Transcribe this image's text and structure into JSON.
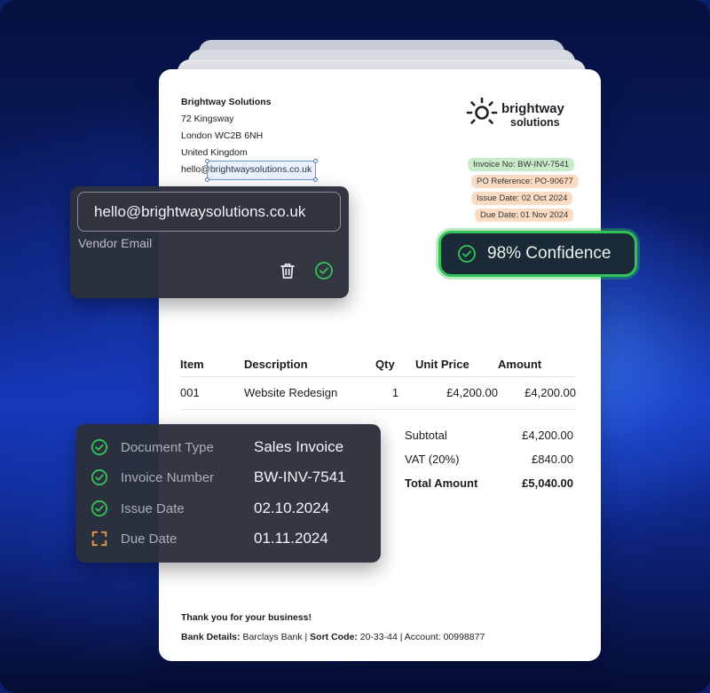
{
  "vendor": {
    "name": "Brightway Solutions",
    "address_line1": "72 Kingsway",
    "address_line2": "London WC2B 6NH",
    "country": "United Kingdom",
    "email": "hello@brightwaysolutions.co.uk"
  },
  "logo": {
    "line1": "brightway",
    "line2": "solutions"
  },
  "tags": {
    "invoice_no": "Invoice No: BW-INV-7541",
    "po_reference": "PO Reference: PO-90677",
    "issue_date": "Issue Date: 02 Oct 2024",
    "due_date": "Due Date: 01 Nov 2024"
  },
  "confidence": {
    "label": "98% Confidence",
    "color": "#33c456"
  },
  "email_panel": {
    "value": "hello@brightwaysolutions.co.uk",
    "label": "Vendor Email",
    "delete_icon": "trash-icon",
    "confirm_icon": "check-circle-icon"
  },
  "table": {
    "headers": [
      "Item",
      "Description",
      "Qty",
      "Unit Price",
      "Amount"
    ],
    "rows": [
      [
        "001",
        "Website Redesign",
        "1",
        "£4,200.00",
        "£4,200.00"
      ]
    ]
  },
  "totals": {
    "subtotal_label": "Subtotal",
    "subtotal": "£4,200.00",
    "vat_label": "VAT (20%)",
    "vat": "£840.00",
    "total_label": "Total Amount",
    "total": "£5,040.00"
  },
  "fields": [
    {
      "label": "Document Type",
      "value": "Sales Invoice",
      "status": "confirmed"
    },
    {
      "label": "Invoice Number",
      "value": "BW-INV-7541",
      "status": "confirmed"
    },
    {
      "label": "Issue Date",
      "value": "02.10.2024",
      "status": "confirmed"
    },
    {
      "label": "Due Date",
      "value": "01.11.2024",
      "status": "pending"
    }
  ],
  "footer": {
    "thanks": "Thank you for your business!",
    "bank_label": "Bank Details:",
    "bank": "Barclays Bank",
    "sort_label": "Sort Code:",
    "sort": "20-33-44",
    "account_label": "Account:",
    "account": "00998877"
  },
  "colors": {
    "accent_green": "#33c456",
    "pending_orange": "#f0a040",
    "tag_green": "#c9ecc8",
    "tag_orange": "#fbdcc2"
  }
}
